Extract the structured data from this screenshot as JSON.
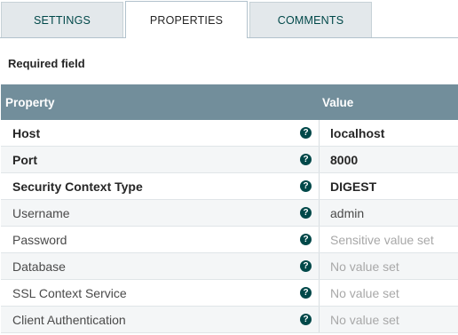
{
  "tabs": [
    {
      "label": "SETTINGS"
    },
    {
      "label": "PROPERTIES"
    },
    {
      "label": "COMMENTS"
    }
  ],
  "active_tab": "PROPERTIES",
  "required_label": "Required field",
  "table": {
    "headers": {
      "property": "Property",
      "value": "Value"
    },
    "help_icon": "?",
    "rows": [
      {
        "name": "Host",
        "value": "localhost"
      },
      {
        "name": "Port",
        "value": "8000"
      },
      {
        "name": "Security Context Type",
        "value": "DIGEST"
      },
      {
        "name": "Username",
        "value": "admin"
      },
      {
        "name": "Password",
        "value": "Sensitive value set"
      },
      {
        "name": "Database",
        "value": "No value set"
      },
      {
        "name": "SSL Context Service",
        "value": "No value set"
      },
      {
        "name": "Client Authentication",
        "value": "No value set"
      }
    ]
  },
  "colors": {
    "header_bg": "#728e9b",
    "help_icon": "#004849",
    "tab_bg": "#e3e8eb",
    "placeholder_text": "#a8a8a8"
  },
  "icons": {
    "help": "question-circle-icon"
  }
}
